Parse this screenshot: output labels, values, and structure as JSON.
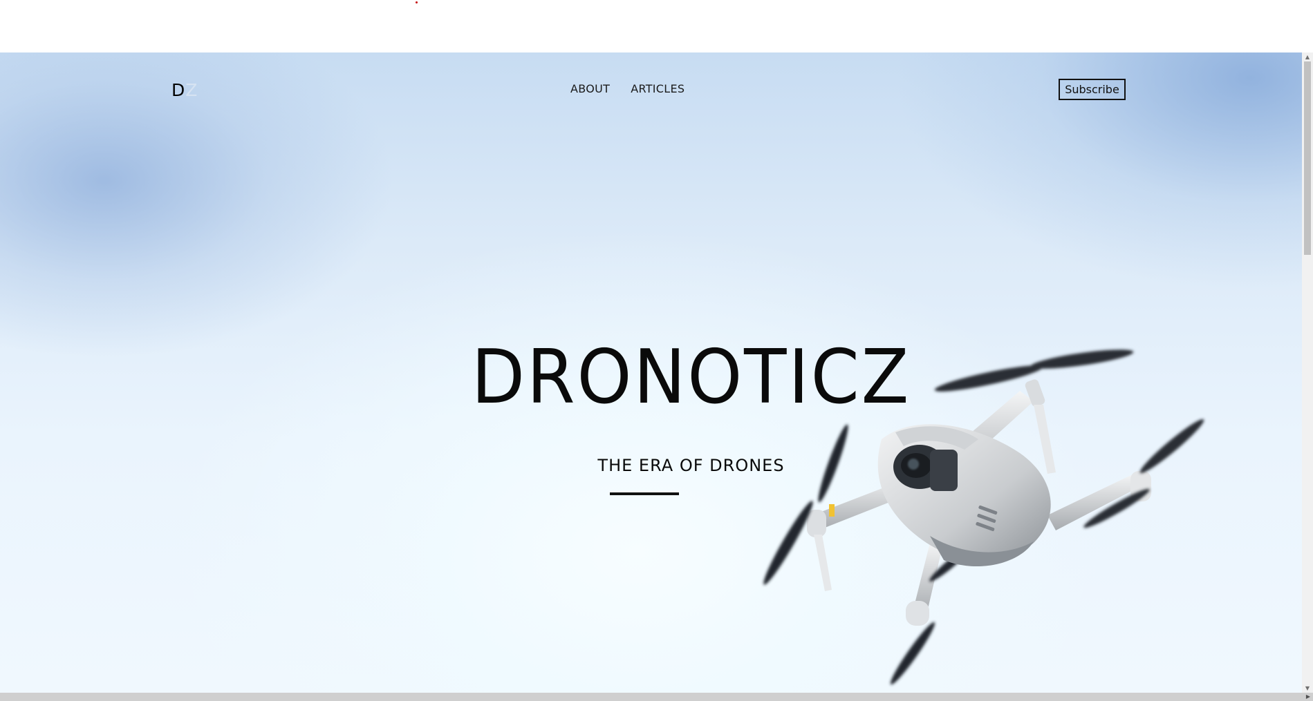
{
  "logo": {
    "letter1": "D",
    "letter2": "Z"
  },
  "nav": {
    "items": [
      {
        "label": "ABOUT"
      },
      {
        "label": "ARTICLES"
      }
    ]
  },
  "header": {
    "subscribe_label": "Subscribe"
  },
  "hero": {
    "title": "DRONOTICZ",
    "subtitle": "THE ERA OF DRONES"
  },
  "icons": {
    "drone": "drone-image",
    "scroll_up": "triangle-up-icon",
    "scroll_down": "triangle-down-icon",
    "scroll_right": "triangle-right-icon"
  },
  "colors": {
    "text": "#0a0a0a",
    "sky_light": "#f0f8fe",
    "sky_dark": "#9dbbe3"
  }
}
